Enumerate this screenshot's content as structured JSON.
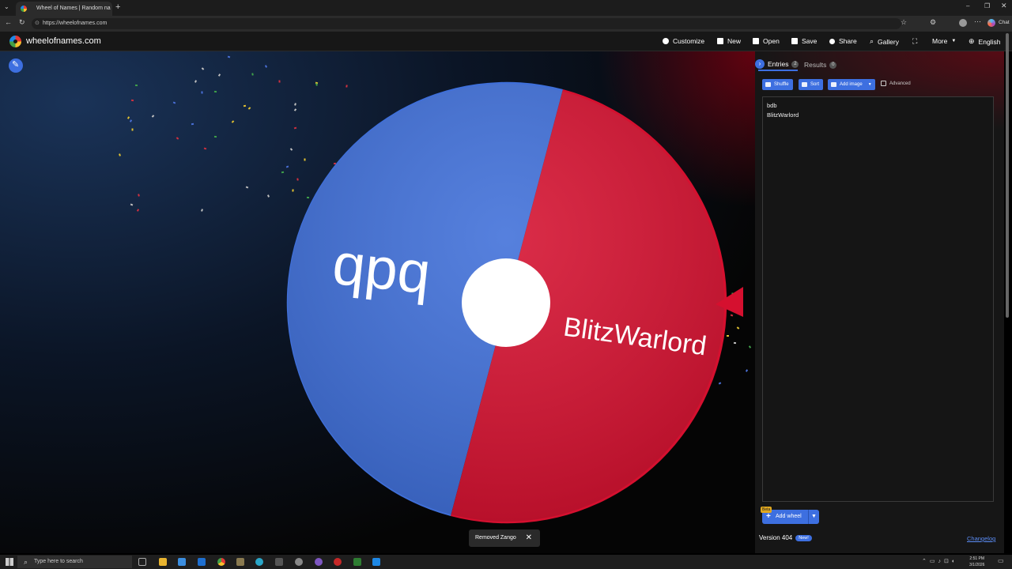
{
  "browser": {
    "tab_title": "Wheel of Names | Random na",
    "url": "https://wheelofnames.com",
    "chat_label": "Chat"
  },
  "site": {
    "name": "wheelofnames.com",
    "nav": {
      "customize": "Customize",
      "new": "New",
      "open": "Open",
      "save": "Save",
      "share": "Share",
      "gallery": "Gallery",
      "more": "More",
      "language": "English"
    }
  },
  "wheel": {
    "slices": [
      {
        "label": "qpq",
        "color": "#3f6fd9"
      },
      {
        "label": "BlitzWarlord",
        "color": "#d5102f"
      }
    ],
    "center_color": "#ffffff",
    "pointer_color": "#d5102f"
  },
  "toast": {
    "message": "Removed Zango"
  },
  "panel": {
    "tabs": {
      "entries_label": "Entries",
      "entries_count": "2",
      "results_label": "Results",
      "results_count": "0"
    },
    "buttons": {
      "shuffle": "Shuffle",
      "sort": "Sort",
      "add_image": "Add image"
    },
    "advanced_label": "Advanced",
    "entries": [
      "bdb",
      "BlitzWarlord"
    ],
    "add_wheel": {
      "label": "Add wheel",
      "badge": "Beta"
    },
    "version": {
      "label": "Version 404",
      "badge": "New!"
    },
    "changelog": "Changelog"
  },
  "taskbar": {
    "search_placeholder": "Type here to search",
    "time": "2:51 PM",
    "date": "3/1/2026"
  },
  "colors": {
    "accent": "#3d6fe0",
    "blue_slice": "#3f6fd9",
    "red_slice": "#d5102f"
  }
}
